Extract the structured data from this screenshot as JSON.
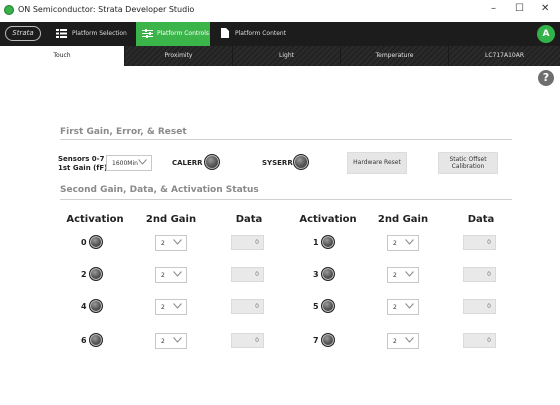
{
  "window": {
    "title": "ON Semiconductor: Strata Developer Studio",
    "controls": [
      "–",
      "☐",
      "✕"
    ]
  },
  "navbar": {
    "logo": "Strata",
    "tabs": [
      {
        "label": "Platform Selection",
        "icon": "list-icon"
      },
      {
        "label": "Platform Controls",
        "icon": "sliders-icon"
      },
      {
        "label": "Platform Content",
        "icon": "document-icon"
      }
    ],
    "active_tab": "Platform Controls",
    "user_initial": "A",
    "accent_color": "#3bb44a"
  },
  "subtabs": [
    "Touch",
    "Proximity",
    "Light",
    "Temperature",
    "LC717A10AR"
  ],
  "active_subtab": "Touch",
  "help": "?",
  "section1": {
    "title": "First Gain, Error, & Reset",
    "sensors_label_line1": "Sensors 0-7",
    "sensors_label_line2": "1st Gain (fF)",
    "gain_select": "1600Min",
    "calerr_label": "CALERR",
    "syserr_label": "SYSERR",
    "hardware_reset": "Hardware Reset",
    "static_offset_line1": "Static Offset",
    "static_offset_line2": "Calibration"
  },
  "section2": {
    "title": "Second Gain, Data, & Activation Status",
    "headers": [
      "Activation",
      "2nd Gain",
      "Data",
      "Activation",
      "2nd Gain",
      "Data"
    ],
    "rows": [
      {
        "left": {
          "num": "0",
          "gain": "2",
          "data": "0"
        },
        "right": {
          "num": "1",
          "gain": "2",
          "data": "0"
        }
      },
      {
        "left": {
          "num": "2",
          "gain": "2",
          "data": "0"
        },
        "right": {
          "num": "3",
          "gain": "2",
          "data": "0"
        }
      },
      {
        "left": {
          "num": "4",
          "gain": "2",
          "data": "0"
        },
        "right": {
          "num": "5",
          "gain": "2",
          "data": "0"
        }
      },
      {
        "left": {
          "num": "6",
          "gain": "2",
          "data": "0"
        },
        "right": {
          "num": "7",
          "gain": "2",
          "data": "0"
        }
      }
    ]
  }
}
